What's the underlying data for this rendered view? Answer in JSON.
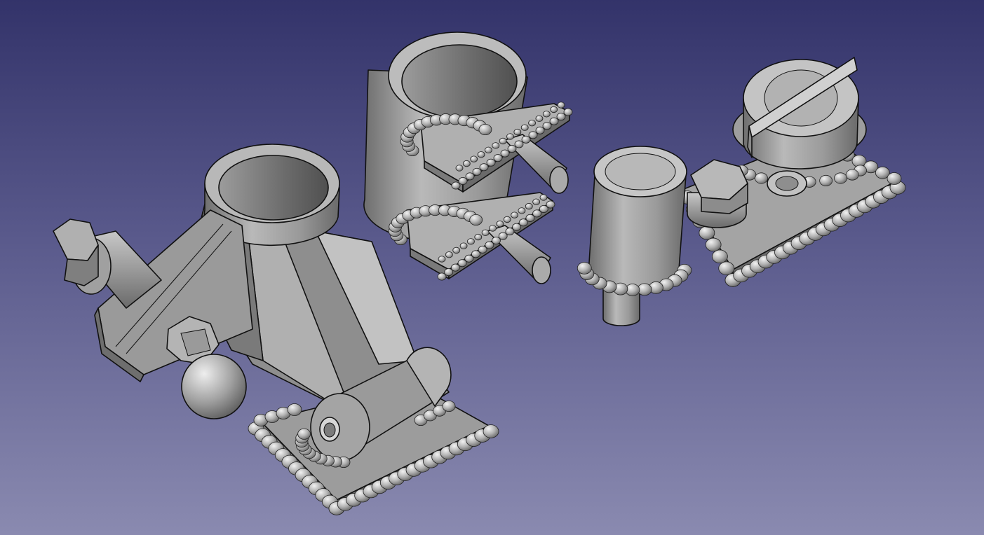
{
  "viewport": {
    "background_top": "#33336a",
    "background_bottom": "#8a8ab0",
    "part_color": "#a8a8a8",
    "edge_color": "#111111"
  },
  "scene": {
    "parts": [
      {
        "id": "bracket-assembly",
        "icon": "hinged-bracket-with-welded-base-plate"
      },
      {
        "id": "tube-clamp-assembly",
        "icon": "tube-with-two-welded-pin-plates"
      },
      {
        "id": "plate-assembly",
        "icon": "base-plate-with-cylinder-cap-and-bolt"
      }
    ]
  }
}
